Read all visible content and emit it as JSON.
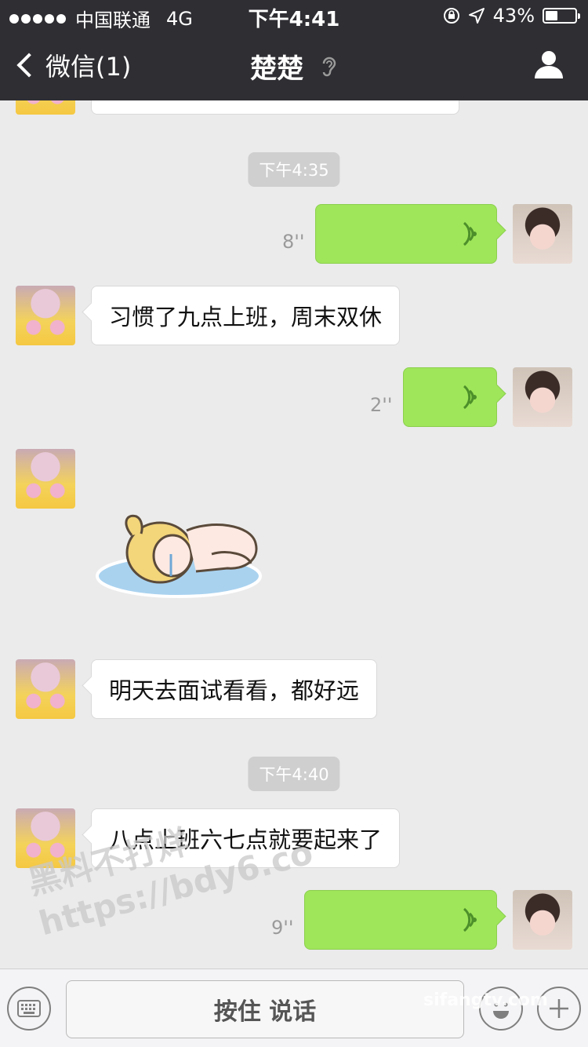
{
  "status_bar": {
    "carrier": "中国联通",
    "network": "4G",
    "time": "下午4:41",
    "battery_percent": "43%",
    "battery_level": 0.43
  },
  "nav": {
    "back_label": "微信(1)",
    "title": "楚楚"
  },
  "messages": {
    "time_1": "下午4:35",
    "voice_1_duration": "8''",
    "text_1": "习惯了九点上班，周末双休",
    "voice_2_duration": "2''",
    "text_2": "明天去面试看看，都好远",
    "time_2": "下午4:40",
    "text_3": "八点上班六七点就要起来了",
    "voice_3_duration": "9''"
  },
  "input_bar": {
    "hold_to_talk": "按住 说话"
  },
  "watermarks": {
    "line1": "黑料不打烊",
    "line2": "https://bdy6.co",
    "site": "sifangtv.com"
  },
  "colors": {
    "nav_bg": "#2e2e33",
    "chat_bg": "#ebebeb",
    "outgoing_bubble": "#9fe65a",
    "incoming_bubble": "#ffffff"
  },
  "icons": {
    "profile": "person-icon",
    "ear": "ear-icon",
    "voice": "voice-wave-icon",
    "keyboard": "keyboard-icon",
    "emoji": "emoji-icon",
    "plus": "plus-icon"
  }
}
